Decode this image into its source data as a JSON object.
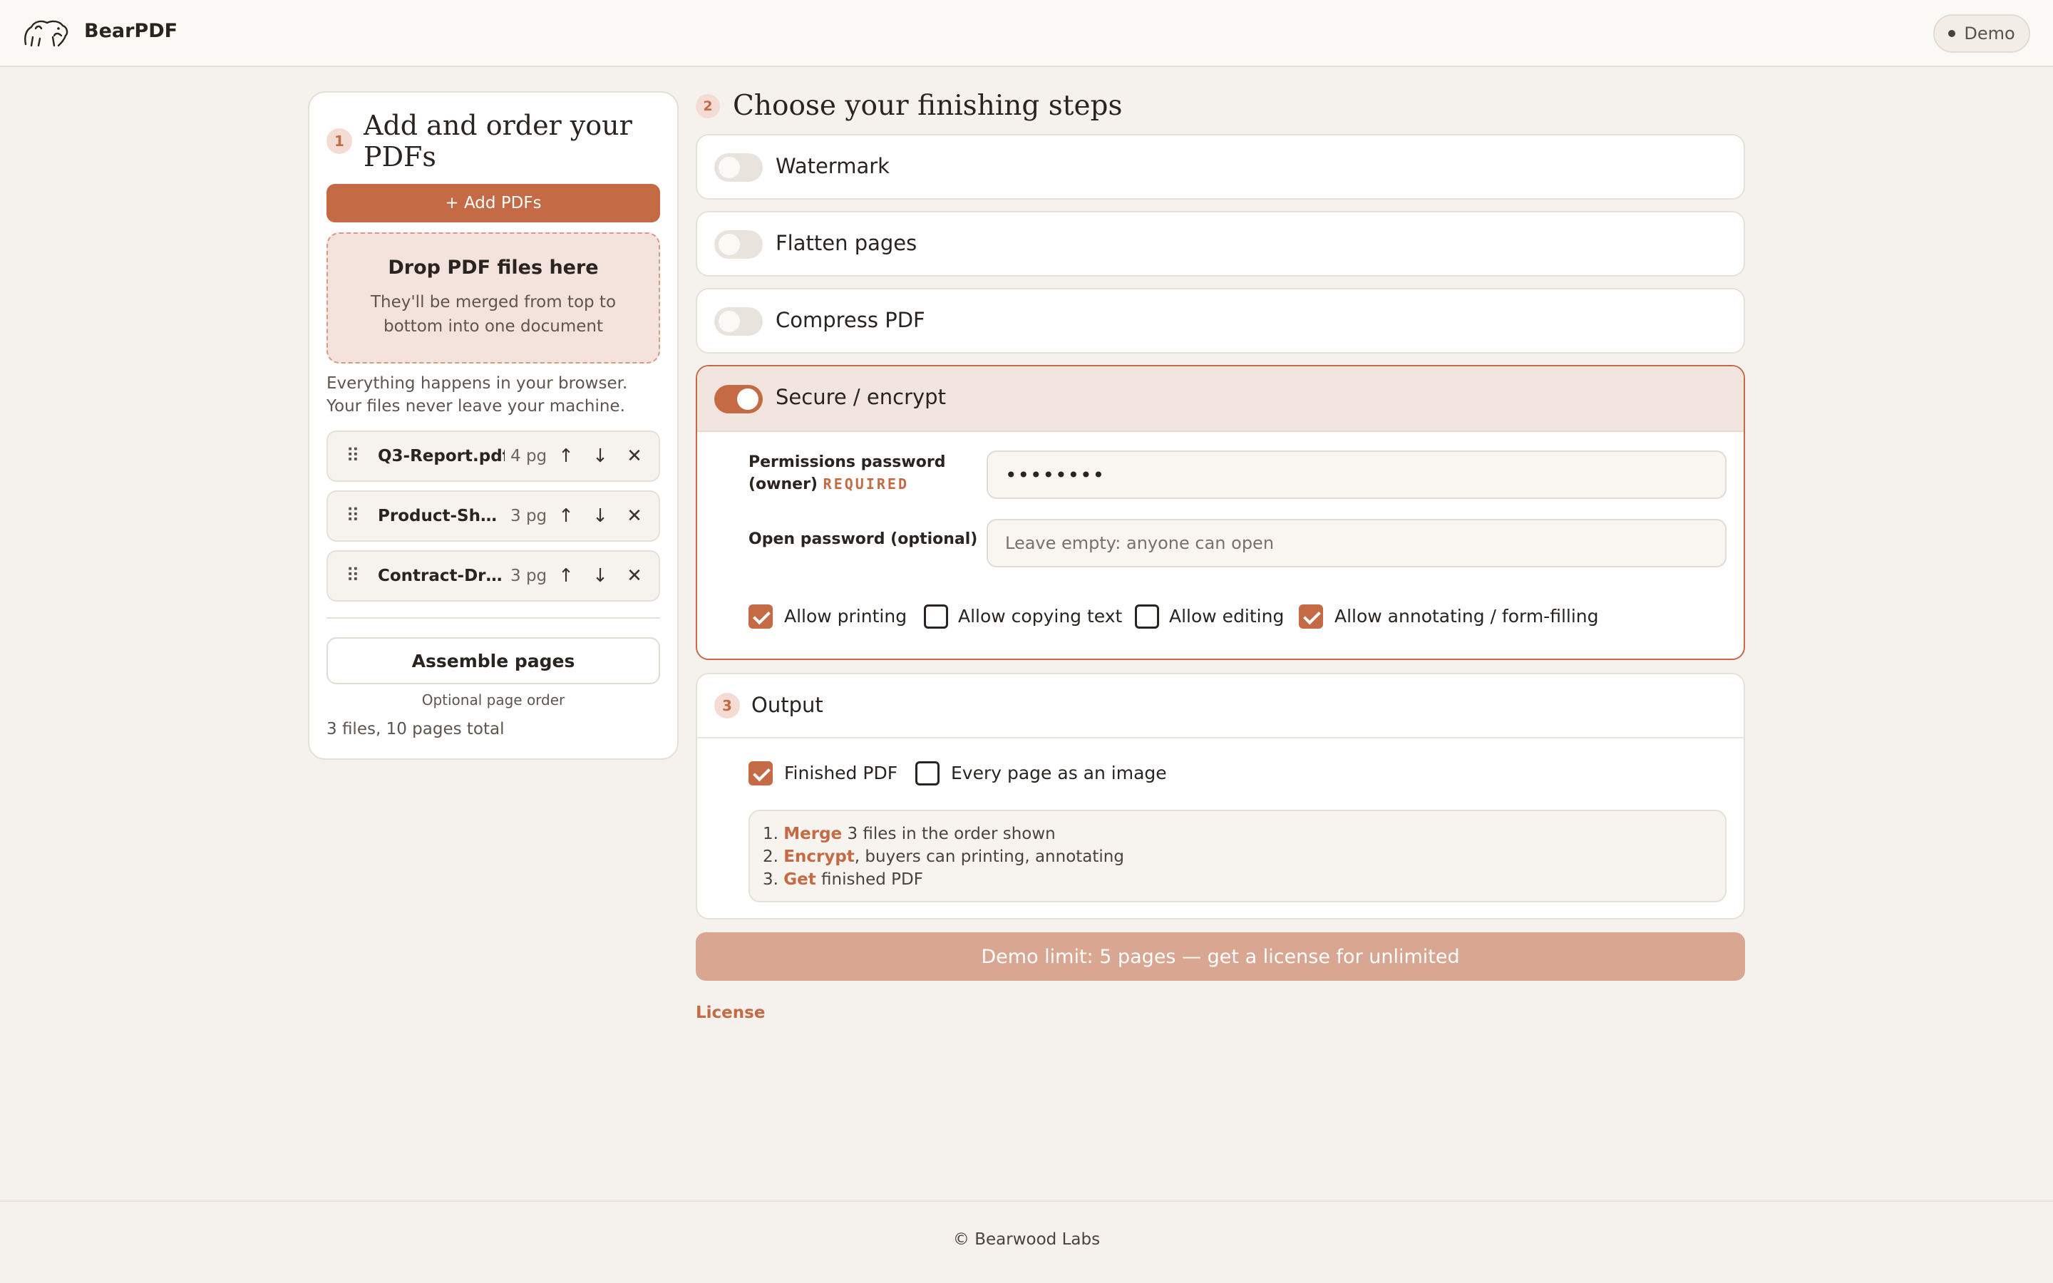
{
  "app": {
    "brand": "BearPDF",
    "demo_badge": "Demo"
  },
  "step1": {
    "number": "1",
    "title": "Add and order your PDFs",
    "add_button": "+ Add PDFs",
    "drop_title": "Drop PDF files here",
    "drop_sub": "They'll be merged from top to bottom into one document",
    "note": "Everything happens in your browser. Your files never leave your machine.",
    "files": [
      {
        "name": "Q3-Report.pdf",
        "pages": "4  pg"
      },
      {
        "name": "Product-Sheet.pdf",
        "pages": "3  pg"
      },
      {
        "name": "Contract-Draft.pdf",
        "pages": "3  pg"
      }
    ],
    "assemble_button": "Assemble pages",
    "assemble_sub": "Optional page order",
    "total": "3 files, 10 pages total"
  },
  "step2": {
    "number": "2",
    "title": "Choose your finishing steps",
    "steps": [
      {
        "label": "Watermark",
        "enabled": false
      },
      {
        "label": "Flatten pages",
        "enabled": false
      },
      {
        "label": "Compress PDF",
        "enabled": false
      },
      {
        "label": "Secure / encrypt",
        "enabled": true
      }
    ],
    "secure": {
      "owner_label_1": "Permissions password",
      "owner_label_2": "(owner)",
      "required_tag": "REQUIRED",
      "owner_value": "••••••••",
      "open_label": "Open password (optional)",
      "open_placeholder": "Leave empty: anyone can open",
      "permissions": [
        {
          "label": "Allow printing",
          "checked": true
        },
        {
          "label": "Allow copying text",
          "checked": false
        },
        {
          "label": "Allow editing",
          "checked": false
        },
        {
          "label": "Allow annotating / form-filling",
          "checked": true
        }
      ]
    }
  },
  "step3": {
    "number": "3",
    "title": "Output",
    "options": [
      {
        "label": "Finished PDF",
        "checked": true
      },
      {
        "label": "Every page as an image",
        "checked": false
      }
    ],
    "summary": [
      {
        "num": "1. ",
        "verb": "Merge",
        "rest": " 3 files in the order shown"
      },
      {
        "num": "2. ",
        "verb": "Encrypt",
        "rest": ", buyers can printing, annotating"
      },
      {
        "num": "3. ",
        "verb": "Get",
        "rest": " finished PDF"
      }
    ]
  },
  "demo_limit": "Demo limit: 5 pages — get a license for unlimited",
  "license_link": "License",
  "footer": "© Bearwood Labs",
  "colors": {
    "accent": "#c46b45",
    "accent_soft": "#d9a791",
    "background": "#f5f1ec"
  },
  "icons": {
    "grip": "drag-handle-icon",
    "up": "arrow-up-icon",
    "down": "arrow-down-icon",
    "remove": "close-icon"
  }
}
